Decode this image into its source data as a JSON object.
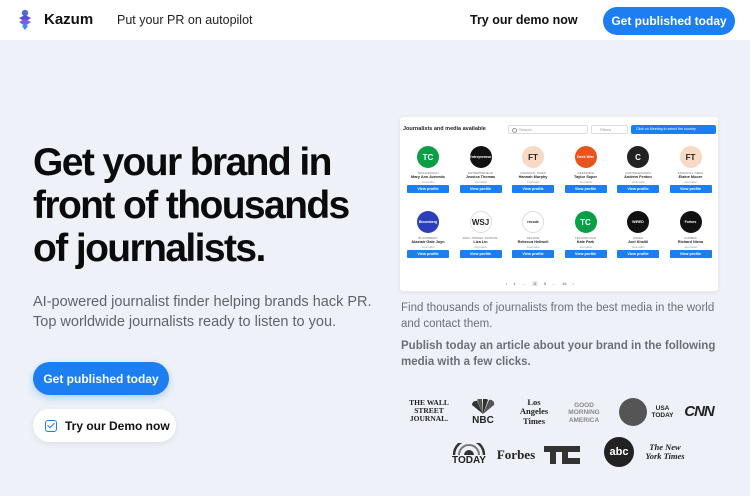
{
  "header": {
    "brand": "Kazum",
    "tagline": "Put your PR on autopilot",
    "demo_link": "Try our demo now",
    "cta": "Get published today"
  },
  "hero": {
    "headline": "Get your brand in front of thousands of journalists.",
    "subtext": "AI-powered journalist finder helping brands hack PR. Top worldwide journalists ready to listen to you.",
    "cta_primary": "Get published today",
    "cta_secondary": "Try our Demo now"
  },
  "panel": {
    "title": "Journalists and media available",
    "search_placeholder": "Search",
    "filter_label": "Filters",
    "banner": "Click on Meeting to select the country",
    "button_label": "View profile",
    "cards": [
      {
        "logo": "TC",
        "outlet": "TECHCRUNCH",
        "name": "Mary Ann Azevedo",
        "role": "Journalist",
        "color": "#0a9e45"
      },
      {
        "logo": "Entrepreneur",
        "outlet": "ENTREPRENEUR",
        "name": "Jessica Thomas",
        "role": "Journalist",
        "color": "#111111"
      },
      {
        "logo": "FT",
        "outlet": "FINANCIAL TIMES",
        "name": "Hannah Murphy",
        "role": "Journalist",
        "color": "#f7d9c4"
      },
      {
        "logo": "Geek Wire",
        "outlet": "GEEKWIRE",
        "name": "Taylor Soper",
        "role": "Journalist",
        "color": "#e8531e"
      },
      {
        "logo": "C",
        "outlet": "COINTELEGRAPH",
        "name": "Andrew Fenton",
        "role": "Journalist",
        "color": "#222222"
      },
      {
        "logo": "FT",
        "outlet": "FINANCIAL TIMES",
        "name": "Elaine Moore",
        "role": "Journalist",
        "color": "#f7d9c4"
      },
      {
        "logo": "Bloomberg",
        "outlet": "BLOOMBERG",
        "name": "Alastair Gale Joyn",
        "role": "Journalist",
        "color": "#2b3fbd"
      },
      {
        "logo": "WSJ",
        "outlet": "WALL STREET JOURNAL",
        "name": "Liza Lin",
        "role": "Journalist",
        "color": "#ffffff"
      },
      {
        "logo": "recode",
        "outlet": "RECODE",
        "name": "Rebecca Heilweil",
        "role": "Journalist",
        "color": "#ffffff"
      },
      {
        "logo": "TC",
        "outlet": "TECHCRUNCH",
        "name": "Kate Park",
        "role": "Journalist",
        "color": "#0a9e45"
      },
      {
        "logo": "WIRED",
        "outlet": "WIRED",
        "name": "Joel Khalili",
        "role": "Journalist",
        "color": "#111111"
      },
      {
        "logo": "Forbes",
        "outlet": "FORBES",
        "name": "Richard Nieva",
        "role": "Journalist",
        "color": "#111111"
      }
    ],
    "pager": [
      "‹",
      "1",
      "…",
      "4",
      "5",
      "…",
      "16",
      "›"
    ]
  },
  "right": {
    "find_text": "Find thousands of journalists from the best media in the world and contact them.",
    "publish_text": "Publish today an article about your brand in the following media with a few clicks."
  },
  "media_logos": {
    "wsj": "THE WALL STREET JOURNAL.",
    "nbc": "NBC",
    "lat": "Los Angeles Times",
    "gma": "GOOD MORNING AMERICA",
    "usatoday": "USA TODAY",
    "cnn": "CNN",
    "today": "TODAY",
    "forbes": "Forbes",
    "tc": "TC",
    "abc": "abc",
    "nyt": "The New York Times"
  },
  "colors": {
    "accent": "#1d7ef2",
    "background": "#eef2f8"
  }
}
